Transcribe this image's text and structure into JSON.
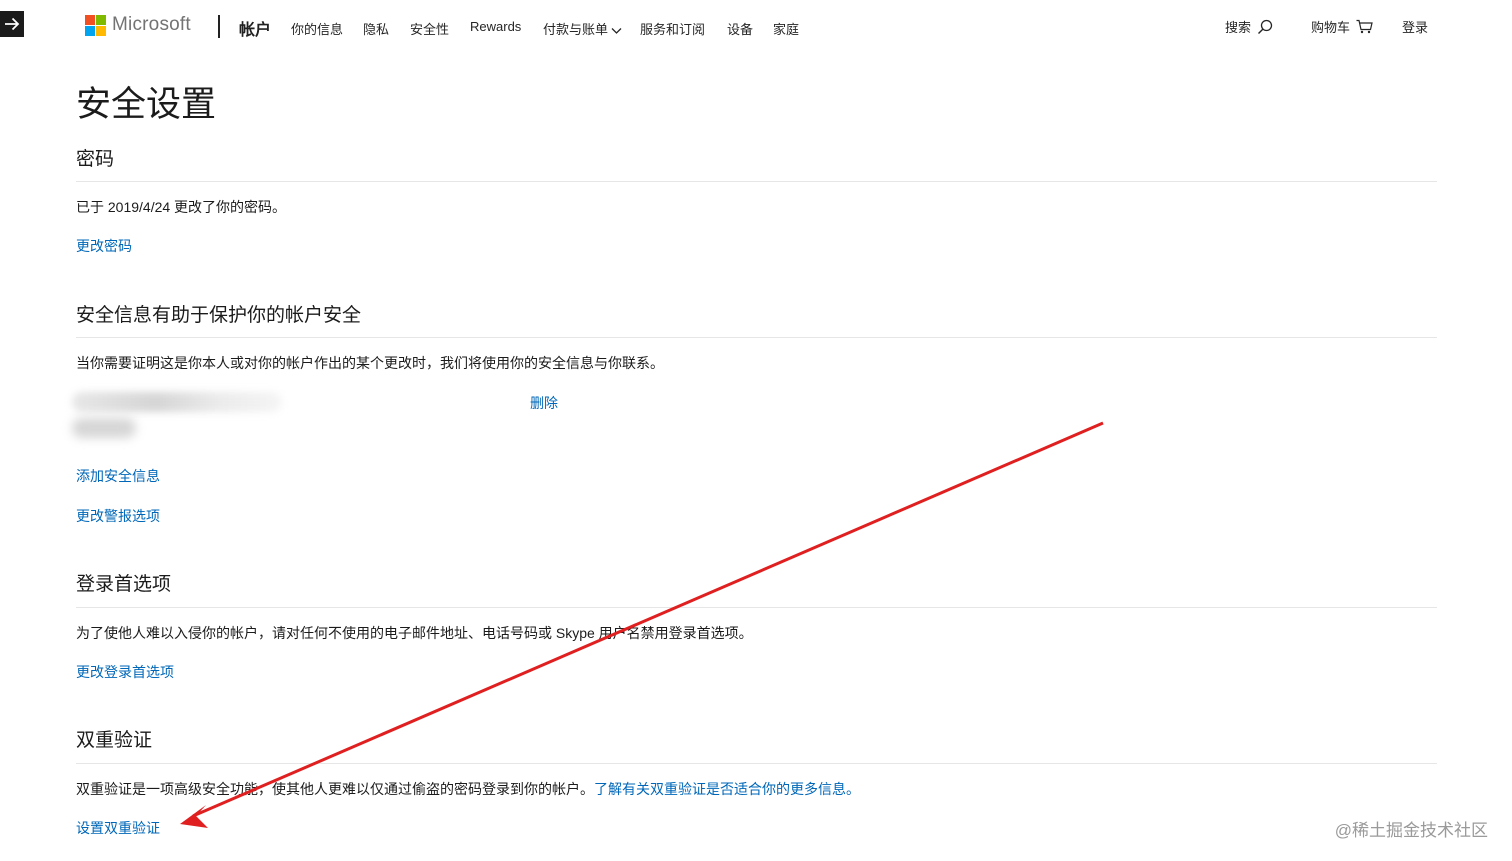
{
  "header": {
    "brand": "Microsoft",
    "section": "帐户",
    "nav_items": [
      {
        "label": "你的信息"
      },
      {
        "label": "隐私"
      },
      {
        "label": "安全性"
      },
      {
        "label": "Rewards"
      },
      {
        "label": "付款与账单"
      },
      {
        "label": "服务和订阅"
      },
      {
        "label": "设备"
      },
      {
        "label": "家庭"
      }
    ],
    "search_label": "搜索",
    "cart_label": "购物车",
    "signin_label": "登录"
  },
  "page": {
    "title": "安全设置"
  },
  "password": {
    "title": "密码",
    "status": "已于 2019/4/24 更改了你的密码。",
    "change_link": "更改密码"
  },
  "security_info": {
    "title": "安全信息有助于保护你的帐户安全",
    "description": "当你需要证明这是你本人或对你的帐户作出的某个更改时，我们将使用你的安全信息与你联系。",
    "delete_link": "删除",
    "add_link": "添加安全信息",
    "alerts_link": "更改警报选项"
  },
  "signin_prefs": {
    "title": "登录首选项",
    "description": "为了使他人难以入侵你的帐户，请对任何不使用的电子邮件地址、电话号码或 Skype 用户名禁用登录首选项。",
    "change_link": "更改登录首选项"
  },
  "two_step": {
    "title": "双重验证",
    "description": "双重验证是一项高级安全功能，使其他人更难以仅通过偷盗的密码登录到你的帐户。",
    "learn_more_link": "了解有关双重验证是否适合你的更多信息。",
    "setup_link": "设置双重验证"
  },
  "watermark": "@稀土掘金技术社区",
  "colors": {
    "link": "#0067b8",
    "annotation_arrow": "#e02020",
    "ms_red": "#f25022",
    "ms_green": "#7fba00",
    "ms_blue": "#00a4ef",
    "ms_yellow": "#ffb900"
  },
  "icons": [
    "exit-arrow-icon",
    "microsoft-logo-icon",
    "chevron-down-icon",
    "search-icon",
    "cart-icon"
  ]
}
